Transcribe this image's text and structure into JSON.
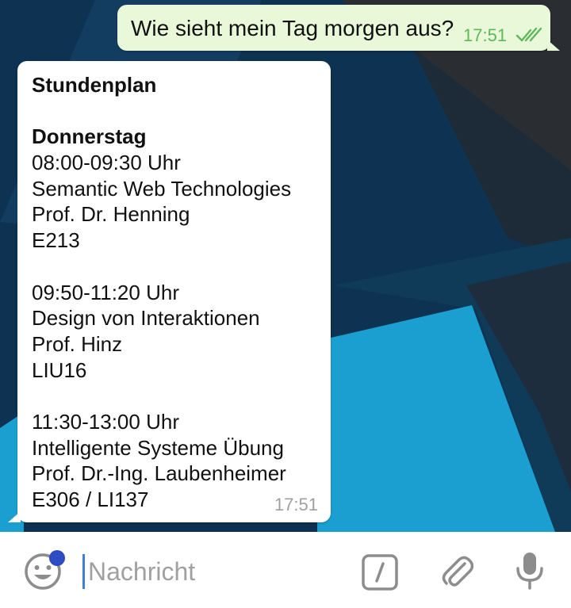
{
  "outgoing_message": {
    "text": "Wie sieht mein Tag morgen aus?",
    "time": "17:51",
    "status_icon": "double-check-icon"
  },
  "incoming_message": {
    "title": "Stundenplan",
    "day": "Donnerstag",
    "lectures": [
      {
        "time": "08:00-09:30 Uhr",
        "course": "Semantic Web Technologies",
        "lecturer": "Prof. Dr. Henning",
        "room": "E213"
      },
      {
        "time": "09:50-11:20 Uhr",
        "course": "Design von Interaktionen",
        "lecturer": "Prof. Hinz",
        "room": "LIU16"
      },
      {
        "time": "11:30-13:00 Uhr",
        "course": "Intelligente Systeme Übung",
        "lecturer": "Prof. Dr.-Ing. Laubenheimer",
        "room": "E306 / LI137"
      }
    ],
    "time": "17:51"
  },
  "input_bar": {
    "placeholder": "Nachricht",
    "icons": [
      "emoji-icon",
      "bot-command-icon",
      "paperclip-icon",
      "microphone-icon"
    ],
    "accent_color": "#2f4bc4"
  },
  "colors": {
    "outgoing_bubble": "#e9f8d9",
    "incoming_bubble": "#ffffff",
    "read_checks": "#5fb85a",
    "wallpaper_dark": "#0d3252",
    "wallpaper_light": "#1a9fd0"
  }
}
